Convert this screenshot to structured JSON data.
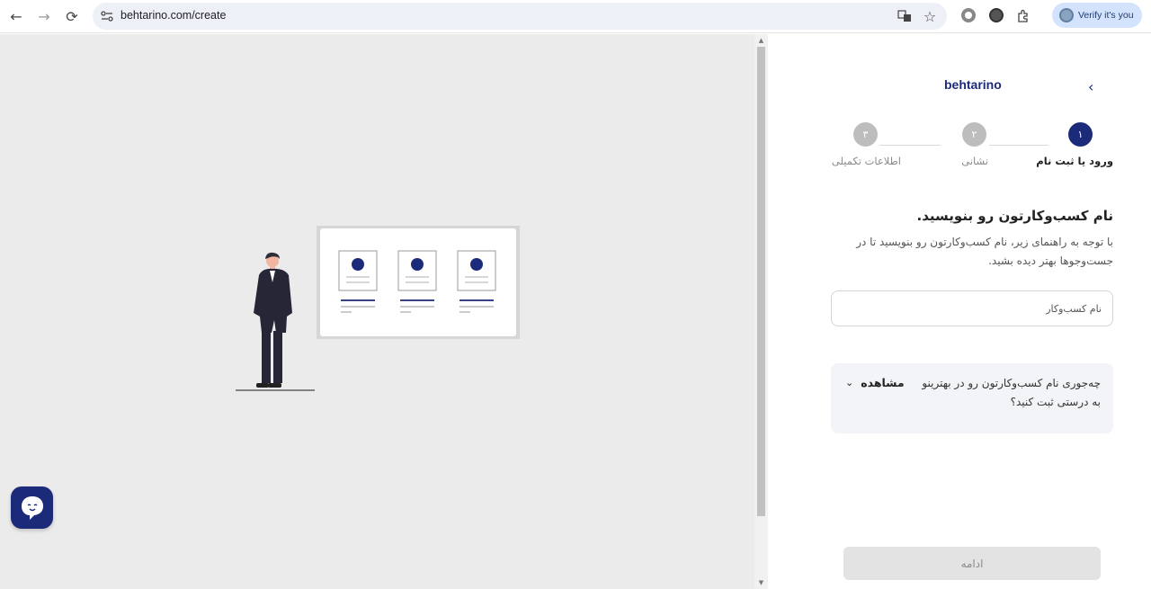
{
  "browser": {
    "url": "behtarino.com/create",
    "profile_label": "Verify it's you",
    "back_icon": "←",
    "forward_icon": "→",
    "reload_icon": "⟳",
    "star_icon": "☆"
  },
  "header": {
    "logo": "behtarino",
    "back_icon": "›"
  },
  "steps": [
    {
      "number": "۱",
      "label": "ورود یا ثبت نام",
      "active": true
    },
    {
      "number": "۲",
      "label": "نشانی",
      "active": false
    },
    {
      "number": "۳",
      "label": "اطلاعات تکمیلی",
      "active": false
    }
  ],
  "form": {
    "title": "نام کسب‌وکارتون رو بنویسید.",
    "description": "با توجه به راهنمای زیر، نام کسب‌وکارتون رو بنویسید تا در جست‌وجوها بهتر دیده بشید.",
    "input_placeholder": "نام کسب‌وکار",
    "help_text": "چه‌جوری نام کسب‌وکارتون رو در بهترینو به درستی ثبت کنید؟",
    "help_toggle": "مشاهده",
    "continue_label": "ادامه"
  },
  "colors": {
    "brand": "#1c2a7a",
    "step_inactive": "#bdbdbd"
  }
}
